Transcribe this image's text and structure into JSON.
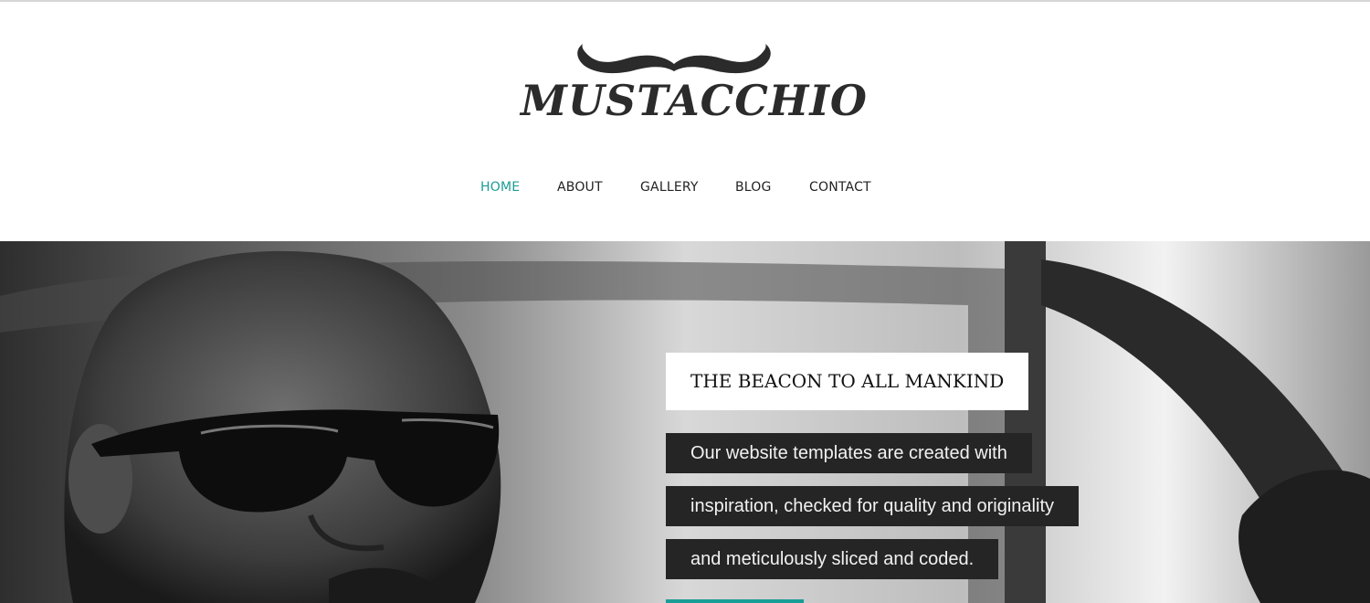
{
  "brand": {
    "name": "MUSTACCHIO"
  },
  "nav": {
    "items": [
      {
        "label": "HOME",
        "active": true
      },
      {
        "label": "ABOUT",
        "active": false
      },
      {
        "label": "GALLERY",
        "active": false
      },
      {
        "label": "BLOG",
        "active": false
      },
      {
        "label": "CONTACT",
        "active": false
      }
    ]
  },
  "hero": {
    "title": "THE BEACON TO ALL MANKIND",
    "lines": [
      "Our website templates are created with",
      "inspiration, checked for quality and originality",
      "and meticulously sliced and coded."
    ]
  },
  "colors": {
    "accent": "#1a9c97",
    "text": "#222222",
    "caption_bg": "#252525",
    "title_bg": "#ffffff"
  }
}
